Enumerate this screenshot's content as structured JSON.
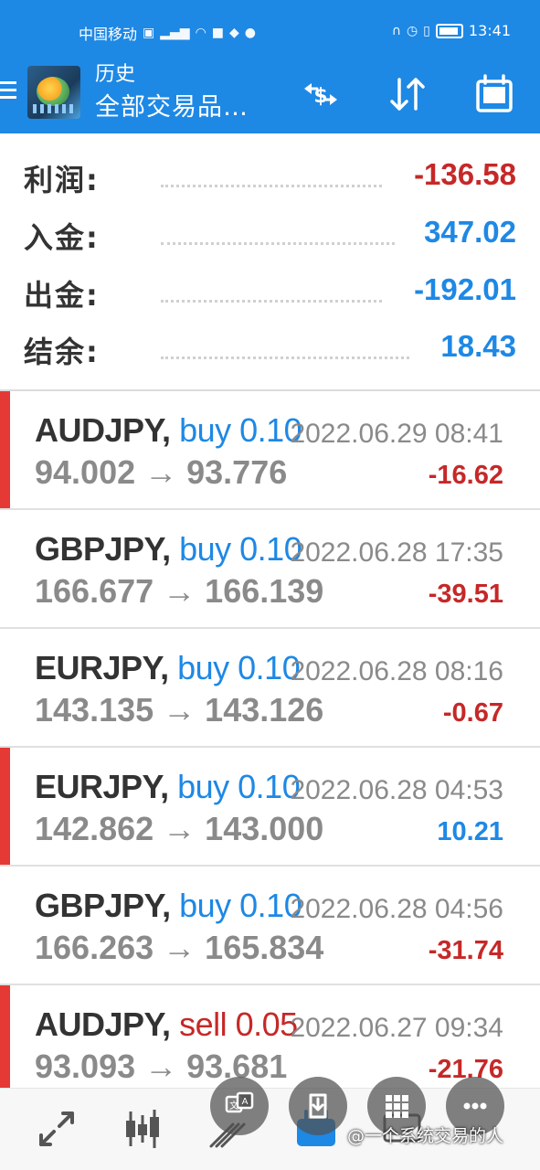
{
  "status_bar": {
    "carrier": "中国移动",
    "time": "13:41"
  },
  "app_bar": {
    "title": "历史",
    "subtitle": "全部交易品…",
    "icons": [
      "menu-icon",
      "metatrader-logo",
      "exchange-dollar-icon",
      "sort-icon",
      "calendar-icon"
    ]
  },
  "summary": {
    "profit": {
      "label": "利润:",
      "value": "-136.58",
      "color": "#c62828"
    },
    "deposit": {
      "label": "入金:",
      "value": "347.02",
      "color": "#1e88e5"
    },
    "withdrawal": {
      "label": "出金:",
      "value": "-192.01",
      "color": "#1e88e5"
    },
    "balance": {
      "label": "结余:",
      "value": "18.43",
      "color": "#1e88e5"
    }
  },
  "trades": [
    {
      "symbol": "AUDJPY,",
      "side": "buy",
      "volume": "0.10",
      "datetime": "2022.06.29 08:41",
      "open": "94.002",
      "close": "93.776",
      "profit": "-16.62",
      "highlight": true
    },
    {
      "symbol": "GBPJPY,",
      "side": "buy",
      "volume": "0.10",
      "datetime": "2022.06.28 17:35",
      "open": "166.677",
      "close": "166.139",
      "profit": "-39.51",
      "highlight": false
    },
    {
      "symbol": "EURJPY,",
      "side": "buy",
      "volume": "0.10",
      "datetime": "2022.06.28 08:16",
      "open": "143.135",
      "close": "143.126",
      "profit": "-0.67",
      "highlight": false
    },
    {
      "symbol": "EURJPY,",
      "side": "buy",
      "volume": "0.10",
      "datetime": "2022.06.28 04:53",
      "open": "142.862",
      "close": "143.000",
      "profit": "10.21",
      "highlight": true
    },
    {
      "symbol": "GBPJPY,",
      "side": "buy",
      "volume": "0.10",
      "datetime": "2022.06.28 04:56",
      "open": "166.263",
      "close": "165.834",
      "profit": "-31.74",
      "highlight": false
    },
    {
      "symbol": "AUDJPY,",
      "side": "sell",
      "volume": "0.05",
      "datetime": "2022.06.27 09:34",
      "open": "93.093",
      "close": "93.681",
      "profit": "-21.76",
      "highlight": true
    }
  ],
  "arrow": "→",
  "bottom_nav": [
    "quotes-icon",
    "chart-candles-icon",
    "trade-icon",
    "history-icon",
    "messages-icon"
  ],
  "watermark": "@一个系统交易的人",
  "colors": {
    "accent": "#1e88e5",
    "loss": "#c62828",
    "marker": "#e53935"
  }
}
